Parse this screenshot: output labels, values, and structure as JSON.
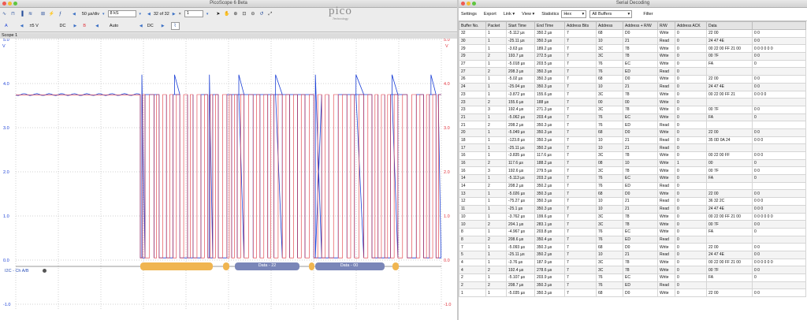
{
  "scope": {
    "title": "PicoScope 6 Beta",
    "timebase": "50 µs/div",
    "samples": "8 kS",
    "capture_position": "32 of 32",
    "zoom": "1",
    "channel_a": {
      "name": "A",
      "range": "±5 V",
      "coupling": "DC",
      "color": "#1a3fd6"
    },
    "channel_b": {
      "name": "B",
      "range": "Auto",
      "coupling": "DC",
      "color": "#e0303a"
    },
    "tab_label": "Scope 1",
    "logo_text": "pico",
    "logo_subtext": "Technology",
    "left_axis_unit": "V",
    "right_axis_unit": "V",
    "left_ticks": [
      "5.0",
      "4.0",
      "3.0",
      "2.0",
      "1.0",
      "0.0",
      "-1.0"
    ],
    "right_ticks": [
      "5.0",
      "4.0",
      "3.0",
      "2.0",
      "1.0",
      "0.0",
      "-1.0"
    ],
    "decode_label": "I2C - Ch A/B",
    "packets": [
      "Data - 22",
      "Data - 00"
    ]
  },
  "decoder": {
    "title": "Serial Decoding",
    "toolbar": {
      "settings": "Settings",
      "export": "Export",
      "link": "Link",
      "view": "View",
      "statistics": "Statistics",
      "format": "Hex",
      "buffers": "All Buffers",
      "filter": "Filter"
    },
    "columns": [
      "Buffer No.",
      "Packet",
      "Start Time",
      "End Time",
      "Address Bits",
      "Address",
      "Address + R/W",
      "R/W",
      "Address ACK",
      "Data",
      ""
    ],
    "rows": [
      [
        "32",
        "1",
        "-5.112 µs",
        "350.2 µs",
        "7",
        "68",
        "D0",
        "Write",
        "0",
        "22 00",
        "0 0"
      ],
      [
        "30",
        "1",
        "-25.11 µs",
        "350.3 µs",
        "7",
        "10",
        "21",
        "Read",
        "0",
        "24 47 4E",
        "0 0"
      ],
      [
        "29",
        "1",
        "-3.63 µs",
        "189.2 µs",
        "7",
        "3C",
        "78",
        "Write",
        "0",
        "00 22 00 FF 21 00",
        "0 0 0 0 0 0"
      ],
      [
        "29",
        "2",
        "193.7 µs",
        "272.5 µs",
        "7",
        "3C",
        "78",
        "Write",
        "0",
        "00 7F",
        "0 0"
      ],
      [
        "27",
        "1",
        "-5.018 µs",
        "203.5 µs",
        "7",
        "76",
        "EC",
        "Write",
        "0",
        "FA",
        "0"
      ],
      [
        "27",
        "2",
        "208.3 µs",
        "350.3 µs",
        "7",
        "76",
        "ED",
        "Read",
        "0",
        "",
        ""
      ],
      [
        "26",
        "1",
        "-5.02 µs",
        "350.3 µs",
        "7",
        "68",
        "D0",
        "Write",
        "0",
        "22 00",
        "0 0"
      ],
      [
        "24",
        "1",
        "-25.04 µs",
        "350.3 µs",
        "7",
        "10",
        "21",
        "Read",
        "0",
        "24 47 4E",
        "0 0"
      ],
      [
        "23",
        "1",
        "-3.872 µs",
        "155.6 µs",
        "7",
        "3C",
        "78",
        "Write",
        "0",
        "00 22 00 FF 21",
        "0 0 0 0"
      ],
      [
        "23",
        "2",
        "155.6 µs",
        "188 µs",
        "7",
        "00",
        "00",
        "Write",
        "0",
        "",
        ""
      ],
      [
        "23",
        "3",
        "192.4 µs",
        "271.3 µs",
        "7",
        "3C",
        "78",
        "Write",
        "0",
        "00 7F",
        "0 0"
      ],
      [
        "21",
        "1",
        "-5.062 µs",
        "203.4 µs",
        "7",
        "76",
        "EC",
        "Write",
        "0",
        "FA",
        "0"
      ],
      [
        "21",
        "2",
        "208.2 µs",
        "350.3 µs",
        "7",
        "76",
        "ED",
        "Read",
        "0",
        "",
        ""
      ],
      [
        "20",
        "1",
        "-5.049 µs",
        "350.3 µs",
        "7",
        "68",
        "D0",
        "Write",
        "0",
        "22 00",
        "0 0"
      ],
      [
        "18",
        "1",
        "-123.8 µs",
        "350.3 µs",
        "7",
        "10",
        "21",
        "Read",
        "0",
        "35 0D 0A 24",
        "0 0 0"
      ],
      [
        "17",
        "1",
        "-25.11 µs",
        "350.2 µs",
        "7",
        "10",
        "21",
        "Read",
        "0",
        "",
        ""
      ],
      [
        "16",
        "1",
        "-3.835 µs",
        "117.6 µs",
        "7",
        "3C",
        "78",
        "Write",
        "0",
        "00 22 00 FF",
        "0 0 0"
      ],
      [
        "16",
        "2",
        "117.6 µs",
        "188.2 µs",
        "7",
        "08",
        "10",
        "Write",
        "1",
        "00",
        "0"
      ],
      [
        "16",
        "3",
        "192.6 µs",
        "279.5 µs",
        "7",
        "3C",
        "78",
        "Write",
        "0",
        "00 7F",
        "0 0"
      ],
      [
        "14",
        "1",
        "-5.113 µs",
        "203.2 µs",
        "7",
        "76",
        "EC",
        "Write",
        "0",
        "FA",
        "0"
      ],
      [
        "14",
        "2",
        "208.2 µs",
        "350.2 µs",
        "7",
        "76",
        "ED",
        "Read",
        "0",
        "",
        ""
      ],
      [
        "13",
        "1",
        "-5.026 µs",
        "350.3 µs",
        "7",
        "68",
        "D0",
        "Write",
        "0",
        "22 00",
        "0 0"
      ],
      [
        "12",
        "1",
        "-75.27 µs",
        "350.3 µs",
        "7",
        "10",
        "21",
        "Read",
        "0",
        "36 32 2C",
        "0 0 0"
      ],
      [
        "11",
        "1",
        "-25.1 µs",
        "350.3 µs",
        "7",
        "10",
        "21",
        "Read",
        "0",
        "24 47 4E",
        "0 0 0"
      ],
      [
        "10",
        "1",
        "-3.762 µs",
        "199.6 µs",
        "7",
        "3C",
        "78",
        "Write",
        "0",
        "00 22 00 FF 21 00",
        "0 0 0 0 0 0"
      ],
      [
        "10",
        "2",
        "204.1 µs",
        "283.1 µs",
        "7",
        "3C",
        "78",
        "Write",
        "0",
        "00 7F",
        "0 0"
      ],
      [
        "8",
        "1",
        "-4.967 µs",
        "203.8 µs",
        "7",
        "76",
        "EC",
        "Write",
        "0",
        "FA",
        "0"
      ],
      [
        "8",
        "2",
        "208.6 µs",
        "350.4 µs",
        "7",
        "76",
        "ED",
        "Read",
        "0",
        "",
        ""
      ],
      [
        "7",
        "1",
        "-5.093 µs",
        "350.3 µs",
        "7",
        "68",
        "D0",
        "Write",
        "0",
        "22 00",
        "0 0"
      ],
      [
        "5",
        "1",
        "-25.11 µs",
        "350.2 µs",
        "7",
        "10",
        "21",
        "Read",
        "0",
        "24 47 4E",
        "0 0"
      ],
      [
        "4",
        "1",
        "-3.76 µs",
        "187.9 µs",
        "7",
        "3C",
        "78",
        "Write",
        "0",
        "00 22 00 FF 21 00",
        "0 0 0 0 0 0"
      ],
      [
        "4",
        "2",
        "192.4 µs",
        "278.6 µs",
        "7",
        "3C",
        "78",
        "Write",
        "0",
        "00 7F",
        "0 0"
      ],
      [
        "2",
        "1",
        "-5.107 µs",
        "203.9 µs",
        "7",
        "76",
        "EC",
        "Write",
        "0",
        "FA",
        "0"
      ],
      [
        "2",
        "2",
        "208.7 µs",
        "350.3 µs",
        "7",
        "76",
        "ED",
        "Read",
        "0",
        "",
        ""
      ],
      [
        "1",
        "1",
        "-5.035 µs",
        "350.3 µs",
        "7",
        "68",
        "D0",
        "Write",
        "0",
        "22 00",
        "0 0"
      ]
    ]
  }
}
